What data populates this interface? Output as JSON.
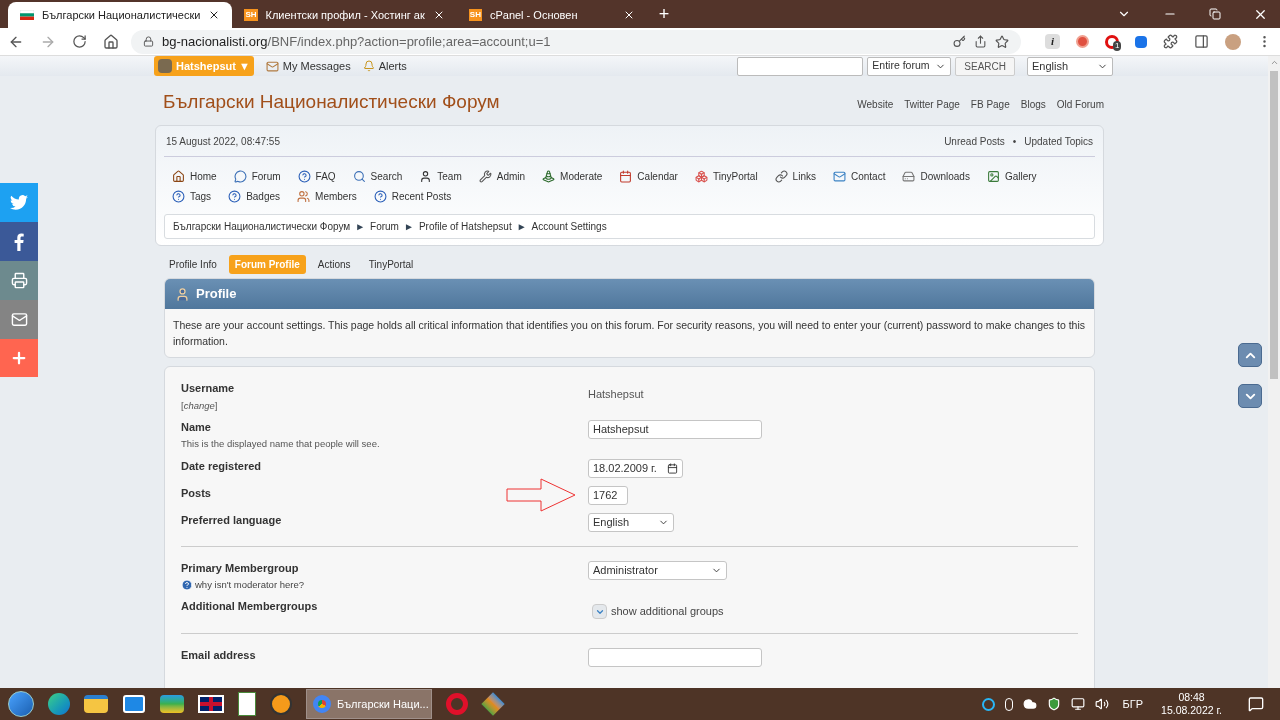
{
  "browser": {
    "tabs": [
      {
        "title": "Български Националистически",
        "selected": true,
        "kind": "flag"
      },
      {
        "title": "Клиентски профил - Хостинг ак",
        "selected": false,
        "kind": "text",
        "favicon": "SH"
      },
      {
        "title": "cPanel - Основен",
        "selected": false,
        "kind": "text",
        "favicon": "SH"
      }
    ],
    "new_tab": "+",
    "url_host": "bg-nacionalisti.org",
    "url_path": "/BNF/index.php?action=profile;area=account;u=1",
    "info_extension": "i",
    "extension_badge": "1"
  },
  "topbar": {
    "user": "Hatshepsut",
    "user_caret": "▼",
    "links": [
      "My Messages",
      "Alerts"
    ],
    "search_scope": "Entire forum",
    "search_button": "SEARCH",
    "language": "English"
  },
  "header": {
    "title": "Български Националистически Форум",
    "links": [
      "Website",
      "Twitter Page",
      "FB Page",
      "Blogs",
      "Old Forum"
    ]
  },
  "info": {
    "date": "15 August 2022, 08:47:55",
    "links": [
      "Unread Posts",
      "Updated Topics"
    ],
    "separator": "•"
  },
  "menu": [
    "Home",
    "Forum",
    "FAQ",
    "Search",
    "Team",
    "Admin",
    "Moderate",
    "Calendar",
    "TinyPortal",
    "Links",
    "Contact",
    "Downloads",
    "Gallery",
    "Tags",
    "Badges",
    "Members",
    "Recent Posts"
  ],
  "breadcrumb": {
    "items": [
      "Български Националистически Форум",
      "Forum",
      "Profile of Hatshepsut",
      "Account Settings"
    ],
    "separator": "►"
  },
  "profile_tabs": [
    {
      "label": "Profile Info",
      "selected": false
    },
    {
      "label": "Forum Profile",
      "selected": true
    },
    {
      "label": "Actions",
      "selected": false
    },
    {
      "label": "TinyPortal",
      "selected": false
    }
  ],
  "panel": {
    "title": "Profile",
    "description": "These are your account settings. This page holds all critical information that identifies you on this forum. For security reasons, you will need to enter your (current) password to make changes to this information."
  },
  "form": [
    [
      {
        "label": "Username",
        "note": "[*change*]",
        "kind": "text",
        "value": "Hatshepsut"
      },
      {
        "label": "Name",
        "note": "This is the displayed name that people will see.",
        "kind": "input",
        "value": "Hatshepsut"
      },
      {
        "label": "Date registered",
        "kind": "date",
        "value": "18.02.2009 г."
      },
      {
        "label": "Posts",
        "kind": "number",
        "value": "1762",
        "highlighted": true
      },
      {
        "label": "Preferred language",
        "kind": "select",
        "value": "English"
      }
    ],
    [
      {
        "label": "Primary Membergroup",
        "note": "why isn't moderator here?",
        "note_help": true,
        "kind": "wideselect",
        "value": "Administrator"
      },
      {
        "label": "Additional Membergroups",
        "kind": "toggle",
        "value": "show additional groups"
      }
    ],
    [
      {
        "label": "Email address",
        "kind": "input"
      }
    ]
  ],
  "taskbar": {
    "active_app": "Български Наци...",
    "language": "БГР",
    "time": "08:48",
    "date": "15.08.2022 г."
  }
}
